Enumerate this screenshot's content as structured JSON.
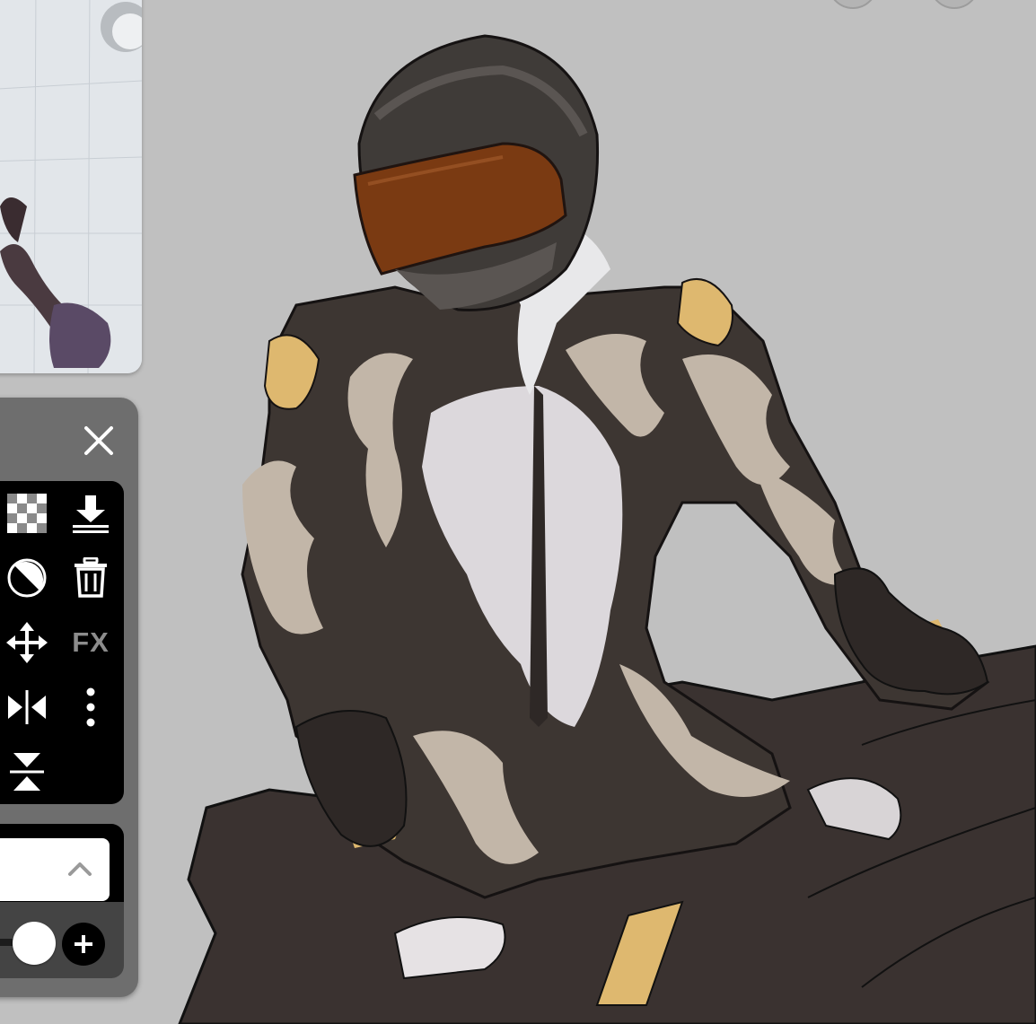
{
  "app": {
    "canvas_background": "#c0c0c0"
  },
  "reference": {
    "icon": "reference-photo"
  },
  "layer_panel": {
    "close_icon": "close-icon",
    "tools": [
      {
        "name": "transparency-checkerboard",
        "icon": "checkerboard-icon"
      },
      {
        "name": "merge-down",
        "icon": "merge-down-icon"
      },
      {
        "name": "invert",
        "icon": "invert-icon"
      },
      {
        "name": "delete",
        "icon": "trash-icon"
      },
      {
        "name": "move",
        "icon": "move-icon"
      },
      {
        "name": "fx",
        "label": "FX"
      },
      {
        "name": "flip-horizontal",
        "icon": "flip-horizontal-icon"
      },
      {
        "name": "more",
        "icon": "vertical-ellipsis-icon"
      },
      {
        "name": "flip-vertical",
        "icon": "flip-vertical-icon"
      }
    ],
    "blend_mode": {
      "value": "",
      "icon": "chevron-up-icon"
    },
    "opacity": {
      "value": 0.33
    },
    "add_icon": "plus-icon"
  },
  "colors": {
    "panel": "#6e6e6e",
    "panel_dark": "#000000",
    "fx_text": "#8c8c8c",
    "suit_dark": "#3d3632",
    "suit_light": "#c2b6a8",
    "accent_gold": "#deb86f",
    "visor": "#7a3a12"
  }
}
